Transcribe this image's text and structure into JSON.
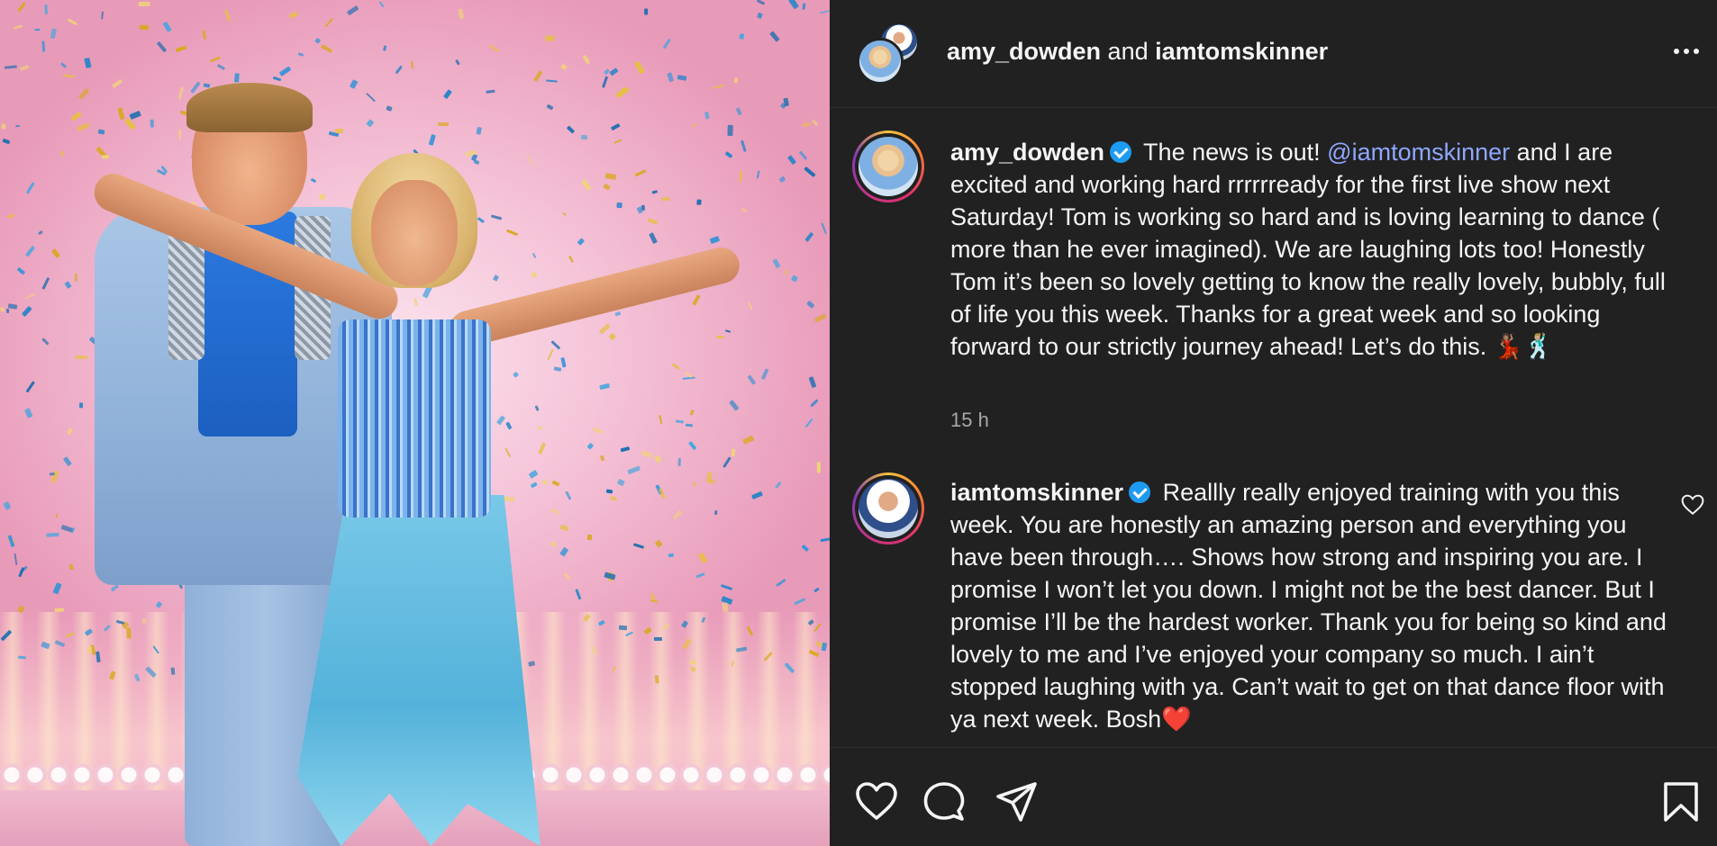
{
  "header": {
    "user_one": "amy_dowden",
    "connector": " and ",
    "user_two": "iamtomskinner",
    "more_icon": "more-horizontal-icon"
  },
  "caption": {
    "username": "amy_dowden",
    "verified": true,
    "text_before": " The news is out! ",
    "mention": "@iamtomskinner",
    "text_after": " and I are excited and working hard rrrrrready for the first live show next Saturday! Tom is working so hard and is loving learning to dance ( more than he ever imagined). We are laughing lots too! Honestly Tom it’s been so lovely getting to know the really lovely, bubbly, full of life you this week. Thanks for a great week and so looking forward to our strictly journey ahead! Let’s do this. 💃🏽🕺🏼",
    "time": "15 h"
  },
  "comment": {
    "username": "iamtomskinner",
    "verified": true,
    "text": " Reallly really enjoyed training with you this week. You are honestly an amazing person and everything you have been through…. Shows how strong and inspiring you are. I promise I won’t let you down. I might not be the best dancer. But I promise I’ll be the hardest worker. Thank you for being so kind and lovely to me and I’ve enjoyed your company so much. I ain’t stopped laughing with ya. Can’t wait to get on that dance floor with ya next week. Bosh❤️"
  },
  "actions": {
    "like": "heart-icon",
    "comment": "comment-icon",
    "share": "share-icon",
    "save": "bookmark-icon"
  },
  "colors": {
    "panel_bg": "#212121",
    "mention": "#8fa6ff",
    "verified": "#1d9bf0",
    "muted_text": "#a8a8a8"
  }
}
